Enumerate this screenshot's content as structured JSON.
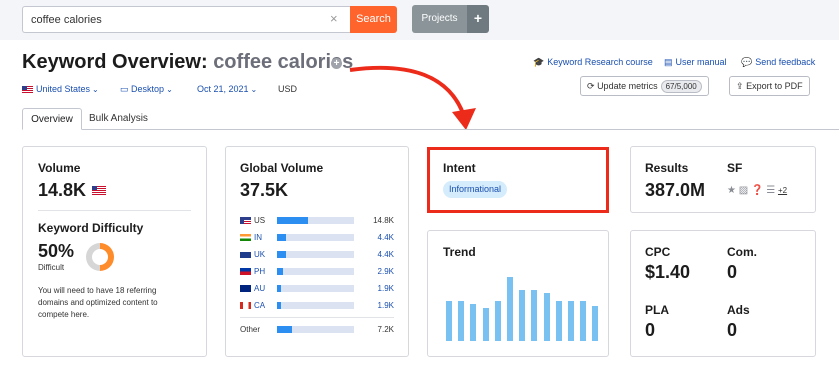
{
  "search": {
    "value": "coffee calories",
    "clear": "×",
    "button": "Search"
  },
  "projects": {
    "label": "Projects",
    "plus": "+"
  },
  "title": {
    "prefix": "Keyword Overview:",
    "keyword": "coffee calories",
    "plus": "+"
  },
  "links": {
    "course": "Keyword Research course",
    "manual": "User manual",
    "feedback": "Send feedback"
  },
  "filters": {
    "country": "United States",
    "device": "Desktop",
    "date": "Oct 21, 2021",
    "currency": "USD"
  },
  "buttons": {
    "update": "Update metrics",
    "quota": "67/5,000",
    "export": "Export to PDF"
  },
  "tabs": {
    "overview": "Overview",
    "bulk": "Bulk Analysis"
  },
  "volume": {
    "title": "Volume",
    "value": "14.8K"
  },
  "kd": {
    "title": "Keyword Difficulty",
    "value": "50%",
    "label": "Difficult",
    "desc1": "You will need to have 18 referring",
    "desc2": "domains and optimized content to",
    "desc3": "compete here."
  },
  "global": {
    "title": "Global Volume",
    "value": "37.5K",
    "rows": [
      {
        "code": "US",
        "value": "14.8K",
        "fraction": 0.4
      },
      {
        "code": "IN",
        "value": "4.4K",
        "fraction": 0.12
      },
      {
        "code": "UK",
        "value": "4.4K",
        "fraction": 0.12
      },
      {
        "code": "PH",
        "value": "2.9K",
        "fraction": 0.08
      },
      {
        "code": "AU",
        "value": "1.9K",
        "fraction": 0.05
      },
      {
        "code": "CA",
        "value": "1.9K",
        "fraction": 0.05
      }
    ],
    "other": {
      "label": "Other",
      "value": "7.2K",
      "fraction": 0.19
    }
  },
  "intent": {
    "title": "Intent",
    "badge": "Informational"
  },
  "trend": {
    "title": "Trend",
    "values": [
      0.62,
      0.62,
      0.58,
      0.52,
      0.62,
      1.0,
      0.8,
      0.8,
      0.75,
      0.62,
      0.62,
      0.62,
      0.55
    ]
  },
  "results": {
    "title": "Results",
    "value": "387.0M"
  },
  "sf": {
    "title": "SF",
    "more": "+2"
  },
  "cpc": {
    "title": "CPC",
    "value": "$1.40"
  },
  "com": {
    "title": "Com.",
    "value": "0"
  },
  "pla": {
    "title": "PLA",
    "value": "0"
  },
  "ads": {
    "title": "Ads",
    "value": "0"
  },
  "colors": {
    "accent": "#ff642d",
    "link": "#1a4fb0",
    "bar": "#2b8ef0",
    "trend": "#78c1f0",
    "highlight": "#ec2b1b"
  }
}
